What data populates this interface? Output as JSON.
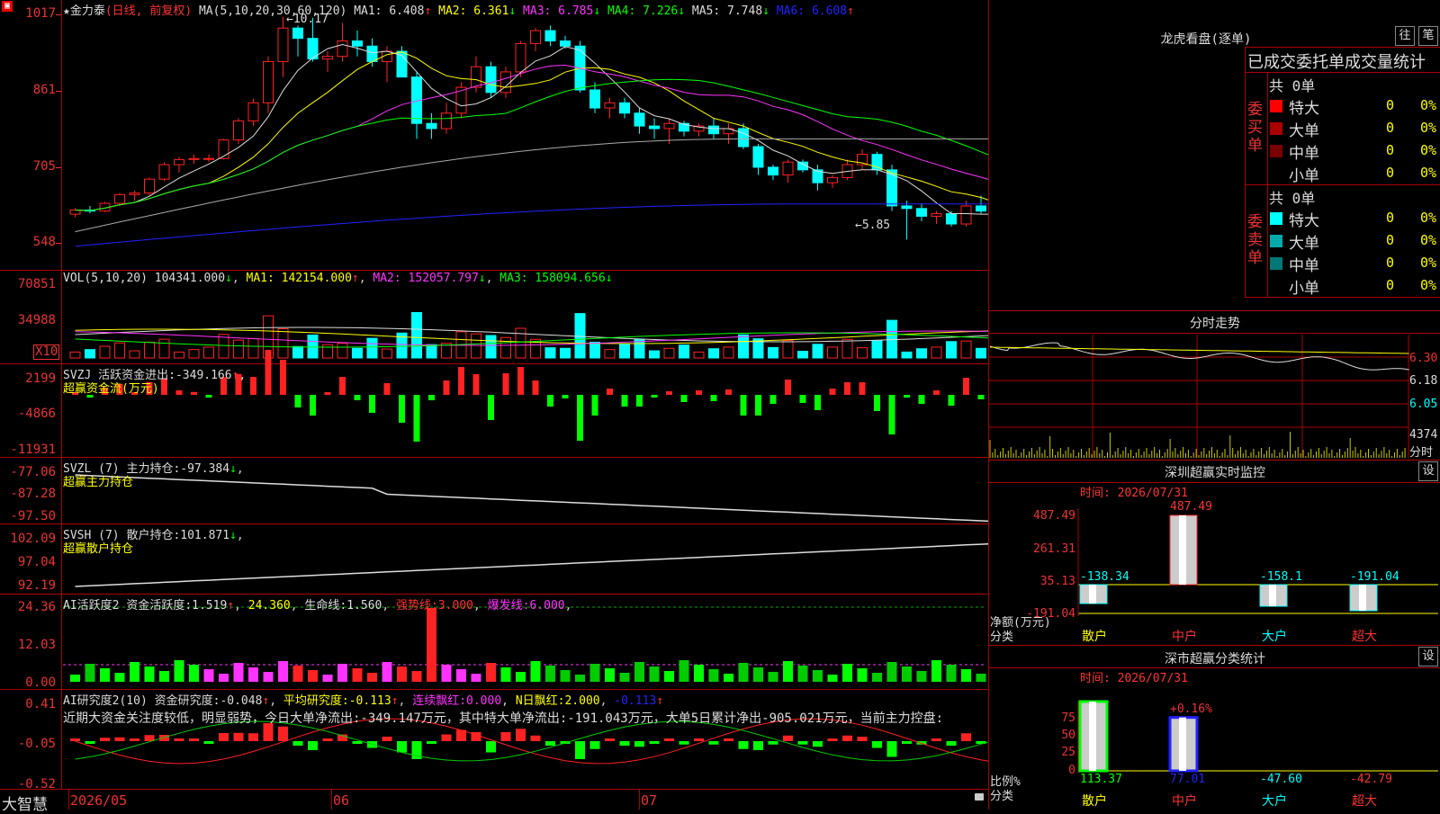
{
  "header": {
    "star": "★",
    "stock_name": "金力泰",
    "mode": "(日线, 前复权)",
    "ma_params": "MA(5,10,20,30,60,120)",
    "ma": [
      {
        "label": "MA1:",
        "value": "6.408",
        "arrow": "↑",
        "color": "#ddd"
      },
      {
        "label": "MA2:",
        "value": "6.361",
        "arrow": "↓",
        "color": "#ff0"
      },
      {
        "label": "MA3:",
        "value": "6.785",
        "arrow": "↓",
        "color": "#f3f"
      },
      {
        "label": "MA4:",
        "value": "7.226",
        "arrow": "↓",
        "color": "#0f0"
      },
      {
        "label": "MA5:",
        "value": "7.748",
        "arrow": "↓",
        "color": "#ddd"
      },
      {
        "label": "MA6:",
        "value": "6.608",
        "arrow": "↑",
        "color": "#22f"
      }
    ],
    "high_note": "←10.17",
    "low_note": "←5.85"
  },
  "price_axis": [
    "1017",
    "861",
    "705",
    "548"
  ],
  "vol": {
    "legend_name": "VOL(5,10,20)",
    "value": "104341.000",
    "arrow": "↓",
    "ma1": "MA1: 142154.000",
    "ma1_arrow": "↑",
    "ma2": "MA2: 152057.797",
    "ma2_arrow": "↓",
    "ma3": "MA3: 158094.656",
    "ma3_arrow": "↓",
    "axis": [
      "70851",
      "34988"
    ],
    "unit": "X10"
  },
  "svzj": {
    "legend_name": "SVZJ",
    "label": "活跃资金进出:",
    "value": "-349.166",
    "arrow": "↑",
    "sub": "超赢资金流(万元)",
    "axis": [
      "2199",
      "-4866",
      "-11931"
    ]
  },
  "svzl": {
    "legend_name": "SVZL (7)",
    "label": "主力持仓:",
    "value": "-97.384",
    "arrow": "↓",
    "sub": "超赢主力持仓",
    "axis": [
      "-77.06",
      "-87.28",
      "-97.50"
    ]
  },
  "svsh": {
    "legend_name": "SVSH (7)",
    "label": "散户持仓:",
    "value": "101.871",
    "arrow": "↓",
    "sub": "超赢散户持仓",
    "axis": [
      "102.09",
      "97.04",
      "92.19"
    ]
  },
  "ai_active": {
    "legend_name": "AI活跃度2",
    "label": "资金活跃度:",
    "value": "1.519",
    "arrow": "↑",
    "v2": "24.360",
    "life_label": "生命线:",
    "life_value": "1.560",
    "strong_label": "强势线:",
    "strong_value": "3.000",
    "burst_label": "爆发线:",
    "burst_value": "6.000",
    "axis": [
      "24.36",
      "12.03",
      "0.00"
    ]
  },
  "ai_research": {
    "legend_name": "AI研究度2(10)",
    "label": "资金研究度:",
    "value": "-0.048",
    "arrow": "↑",
    "avg_label": "平均研究度:",
    "avg_value": "-0.113",
    "avg_arrow": "↑",
    "red_label": "连续飘红:",
    "red_value": "0.000",
    "nred_label": "N日飘红:",
    "nred_value": "2.000",
    "tail": "-0.113",
    "tail_arrow": "↑",
    "comment": "近期大资金关注度较低，明显弱势，今日大单净流出:-349.147万元，其中特大单净流出:-191.043万元，大单5日累计净出-905.021万元，当前主力控盘:",
    "axis": [
      "0.41",
      "-0.05",
      "-0.52"
    ]
  },
  "bottom": {
    "brand": "大智慧",
    "dates": [
      "2026/05",
      "06",
      "07"
    ]
  },
  "dragon": {
    "title": "龙虎看盘(逐单)",
    "btn1": "往",
    "btn2": "笔",
    "subtitle": "已成交委托单成交量统计",
    "buy": {
      "side_label": "委买单",
      "total": "共 0单",
      "rows": [
        {
          "label": "特大",
          "count": "0",
          "pct": "0%",
          "color": "#f00"
        },
        {
          "label": "大单",
          "count": "0",
          "pct": "0%",
          "color": "#a00"
        },
        {
          "label": "中单",
          "count": "0",
          "pct": "0%",
          "color": "#700"
        },
        {
          "label": "小单",
          "count": "0",
          "pct": "0%",
          "color": "#000"
        }
      ]
    },
    "sell": {
      "side_label": "委卖单",
      "total": "共 0单",
      "rows": [
        {
          "label": "特大",
          "count": "0",
          "pct": "0%",
          "color": "#0ff"
        },
        {
          "label": "大单",
          "count": "0",
          "pct": "0%",
          "color": "#0aa"
        },
        {
          "label": "中单",
          "count": "0",
          "pct": "0%",
          "color": "#077"
        },
        {
          "label": "小单",
          "count": "0",
          "pct": "0%",
          "color": "#000"
        }
      ]
    }
  },
  "intraday": {
    "title": "分时走势",
    "axis": [
      "6.30",
      "6.18",
      "6.05"
    ],
    "vol_label": "4374",
    "vol_unit": "分时"
  },
  "monitor": {
    "title": "深圳超赢实时监控",
    "btn": "设",
    "time": "时间: 2026/07/31",
    "axis": [
      "487.49",
      "261.31",
      "35.13",
      "-191.04"
    ],
    "ylabel1": "净额(万元)",
    "ylabel2": "分类",
    "categories": [
      "散户",
      "中户",
      "大户",
      "超大"
    ],
    "values": [
      "-138.34",
      "487.49",
      "-158.1",
      "-191.04"
    ]
  },
  "classify": {
    "title": "深市超赢分类统计",
    "btn": "设",
    "time": "时间: 2026/07/31",
    "axis": [
      "75",
      "50",
      "25",
      "0"
    ],
    "ylabel1": "比例%",
    "ylabel2": "分类",
    "categories": [
      "散户",
      "中户",
      "大户",
      "超大"
    ],
    "values": [
      "113.37",
      "77.01",
      "-47.60",
      "-42.79"
    ],
    "top_note": "+0.16%"
  },
  "chart_data": {
    "type": "candlestick",
    "candles": [
      [
        6.34,
        6.46,
        6.28,
        6.42
      ],
      [
        6.42,
        6.5,
        6.36,
        6.4
      ],
      [
        6.4,
        6.58,
        6.38,
        6.55
      ],
      [
        6.55,
        6.75,
        6.5,
        6.72
      ],
      [
        6.72,
        6.8,
        6.6,
        6.75
      ],
      [
        6.75,
        7.05,
        6.7,
        7.02
      ],
      [
        7.02,
        7.35,
        6.98,
        7.3
      ],
      [
        7.3,
        7.45,
        7.15,
        7.4
      ],
      [
        7.4,
        7.5,
        7.32,
        7.42
      ],
      [
        7.42,
        7.5,
        7.35,
        7.42
      ],
      [
        7.42,
        7.8,
        7.4,
        7.78
      ],
      [
        7.78,
        8.2,
        7.7,
        8.15
      ],
      [
        8.15,
        8.58,
        8.05,
        8.5
      ],
      [
        8.5,
        9.4,
        8.3,
        9.3
      ],
      [
        9.3,
        10.17,
        9.0,
        9.95
      ],
      [
        9.95,
        10.0,
        9.4,
        9.75
      ],
      [
        9.75,
        10.15,
        9.3,
        9.35
      ],
      [
        9.35,
        9.5,
        9.1,
        9.4
      ],
      [
        9.4,
        10.05,
        9.3,
        9.7
      ],
      [
        9.7,
        9.9,
        9.4,
        9.6
      ],
      [
        9.6,
        9.75,
        9.2,
        9.3
      ],
      [
        9.3,
        9.6,
        8.9,
        9.5
      ],
      [
        9.5,
        9.6,
        9.1,
        9.0
      ],
      [
        9.0,
        9.1,
        7.8,
        8.1
      ],
      [
        8.1,
        8.3,
        7.8,
        8.0
      ],
      [
        8.0,
        8.5,
        7.9,
        8.3
      ],
      [
        8.3,
        8.9,
        8.2,
        8.8
      ],
      [
        8.8,
        9.4,
        8.7,
        9.2
      ],
      [
        9.2,
        9.3,
        8.6,
        8.7
      ],
      [
        8.7,
        9.2,
        8.6,
        9.1
      ],
      [
        9.1,
        9.7,
        9.0,
        9.65
      ],
      [
        9.65,
        9.95,
        9.5,
        9.9
      ],
      [
        9.9,
        10.0,
        9.6,
        9.7
      ],
      [
        9.7,
        9.8,
        9.55,
        9.6
      ],
      [
        9.6,
        9.7,
        8.7,
        8.75
      ],
      [
        8.75,
        8.9,
        8.3,
        8.4
      ],
      [
        8.4,
        8.6,
        8.2,
        8.5
      ],
      [
        8.5,
        8.6,
        8.2,
        8.3
      ],
      [
        8.3,
        8.4,
        7.9,
        8.05
      ],
      [
        8.05,
        8.2,
        7.8,
        8.0
      ],
      [
        8.0,
        8.2,
        7.7,
        8.1
      ],
      [
        8.1,
        8.15,
        7.85,
        7.95
      ],
      [
        7.95,
        8.1,
        7.85,
        8.05
      ],
      [
        8.05,
        8.2,
        7.8,
        7.9
      ],
      [
        7.9,
        8.1,
        7.7,
        8.0
      ],
      [
        8.0,
        8.1,
        7.6,
        7.65
      ],
      [
        7.65,
        7.7,
        7.1,
        7.25
      ],
      [
        7.25,
        7.3,
        7.0,
        7.1
      ],
      [
        7.1,
        7.4,
        6.95,
        7.35
      ],
      [
        7.35,
        7.4,
        7.15,
        7.2
      ],
      [
        7.2,
        7.3,
        6.8,
        6.95
      ],
      [
        6.95,
        7.1,
        6.85,
        7.05
      ],
      [
        7.05,
        7.4,
        7.0,
        7.3
      ],
      [
        7.3,
        7.6,
        7.2,
        7.5
      ],
      [
        7.5,
        7.55,
        7.1,
        7.2
      ],
      [
        7.2,
        7.3,
        6.4,
        6.5
      ],
      [
        6.5,
        6.6,
        5.85,
        6.45
      ],
      [
        6.45,
        6.55,
        6.2,
        6.3
      ],
      [
        6.3,
        6.4,
        6.15,
        6.35
      ],
      [
        6.35,
        6.4,
        6.1,
        6.15
      ],
      [
        6.15,
        6.6,
        6.1,
        6.5
      ],
      [
        6.5,
        6.7,
        6.35,
        6.4
      ],
      [
        6.4,
        6.5,
        6.2,
        6.3
      ],
      [
        6.3,
        6.4,
        6.05,
        6.15
      ],
      [
        6.15,
        6.35,
        6.1,
        6.3
      ]
    ],
    "ylim": [
      5.4,
      10.25
    ]
  }
}
